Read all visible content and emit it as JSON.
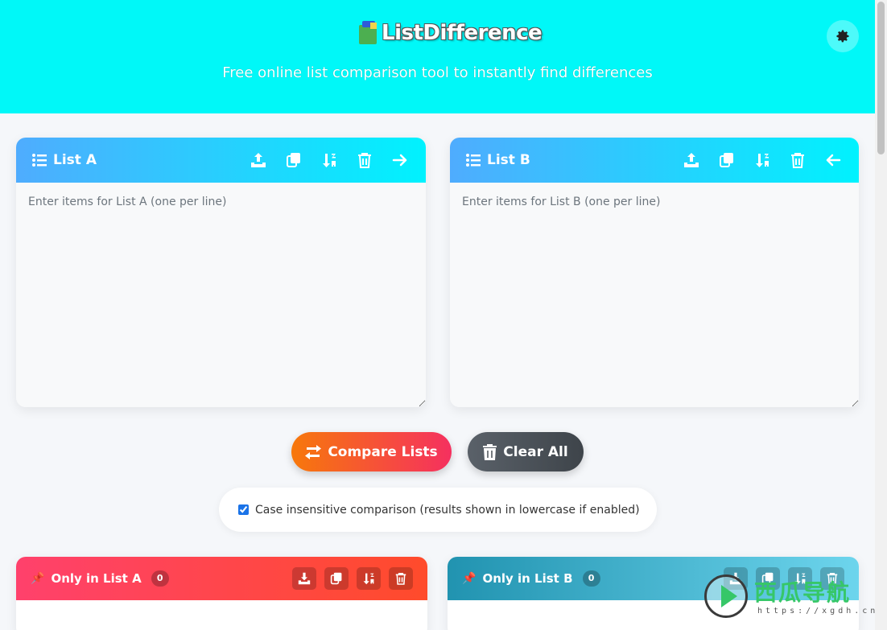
{
  "header": {
    "logo_text": "ListDifference",
    "subtitle": "Free online list comparison tool to instantly find differences",
    "theme_icon": "gear-icon"
  },
  "list_a": {
    "title": "List A",
    "placeholder": "Enter items for List A (one per line)",
    "tools": [
      "upload-icon",
      "copy-icon",
      "sort-icon",
      "trash-icon",
      "arrow-right-icon"
    ]
  },
  "list_b": {
    "title": "List B",
    "placeholder": "Enter items for List B (one per line)",
    "tools": [
      "upload-icon",
      "copy-icon",
      "sort-icon",
      "trash-icon",
      "arrow-left-icon"
    ]
  },
  "actions": {
    "compare_label": "Compare Lists",
    "clear_label": "Clear All"
  },
  "options": {
    "case_insensitive_label": "Case insensitive comparison (results shown in lowercase if enabled)",
    "case_insensitive_checked": true
  },
  "results": {
    "only_a": {
      "title": "Only in List A",
      "count": "0"
    },
    "only_b": {
      "title": "Only in List B",
      "count": "0"
    }
  },
  "watermark": {
    "text": "西瓜导航",
    "url": "https://xgdh.cn"
  },
  "colors": {
    "header_bg": "#00f8f8",
    "panel_header": "#4facfe",
    "compare_btn": "#f7780b",
    "only_a": "#ff416c",
    "only_b": "#2193b0"
  }
}
